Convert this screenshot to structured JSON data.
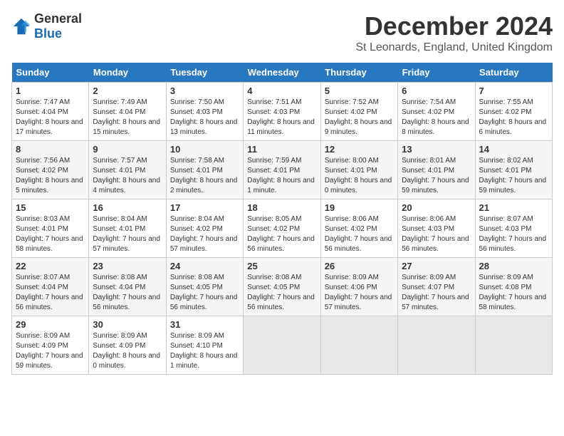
{
  "logo": {
    "general": "General",
    "blue": "Blue"
  },
  "title": "December 2024",
  "location": "St Leonards, England, United Kingdom",
  "days_of_week": [
    "Sunday",
    "Monday",
    "Tuesday",
    "Wednesday",
    "Thursday",
    "Friday",
    "Saturday"
  ],
  "weeks": [
    [
      {
        "day": "1",
        "sunrise": "Sunrise: 7:47 AM",
        "sunset": "Sunset: 4:04 PM",
        "daylight": "Daylight: 8 hours and 17 minutes."
      },
      {
        "day": "2",
        "sunrise": "Sunrise: 7:49 AM",
        "sunset": "Sunset: 4:04 PM",
        "daylight": "Daylight: 8 hours and 15 minutes."
      },
      {
        "day": "3",
        "sunrise": "Sunrise: 7:50 AM",
        "sunset": "Sunset: 4:03 PM",
        "daylight": "Daylight: 8 hours and 13 minutes."
      },
      {
        "day": "4",
        "sunrise": "Sunrise: 7:51 AM",
        "sunset": "Sunset: 4:03 PM",
        "daylight": "Daylight: 8 hours and 11 minutes."
      },
      {
        "day": "5",
        "sunrise": "Sunrise: 7:52 AM",
        "sunset": "Sunset: 4:02 PM",
        "daylight": "Daylight: 8 hours and 9 minutes."
      },
      {
        "day": "6",
        "sunrise": "Sunrise: 7:54 AM",
        "sunset": "Sunset: 4:02 PM",
        "daylight": "Daylight: 8 hours and 8 minutes."
      },
      {
        "day": "7",
        "sunrise": "Sunrise: 7:55 AM",
        "sunset": "Sunset: 4:02 PM",
        "daylight": "Daylight: 8 hours and 6 minutes."
      }
    ],
    [
      {
        "day": "8",
        "sunrise": "Sunrise: 7:56 AM",
        "sunset": "Sunset: 4:02 PM",
        "daylight": "Daylight: 8 hours and 5 minutes."
      },
      {
        "day": "9",
        "sunrise": "Sunrise: 7:57 AM",
        "sunset": "Sunset: 4:01 PM",
        "daylight": "Daylight: 8 hours and 4 minutes."
      },
      {
        "day": "10",
        "sunrise": "Sunrise: 7:58 AM",
        "sunset": "Sunset: 4:01 PM",
        "daylight": "Daylight: 8 hours and 2 minutes."
      },
      {
        "day": "11",
        "sunrise": "Sunrise: 7:59 AM",
        "sunset": "Sunset: 4:01 PM",
        "daylight": "Daylight: 8 hours and 1 minute."
      },
      {
        "day": "12",
        "sunrise": "Sunrise: 8:00 AM",
        "sunset": "Sunset: 4:01 PM",
        "daylight": "Daylight: 8 hours and 0 minutes."
      },
      {
        "day": "13",
        "sunrise": "Sunrise: 8:01 AM",
        "sunset": "Sunset: 4:01 PM",
        "daylight": "Daylight: 7 hours and 59 minutes."
      },
      {
        "day": "14",
        "sunrise": "Sunrise: 8:02 AM",
        "sunset": "Sunset: 4:01 PM",
        "daylight": "Daylight: 7 hours and 59 minutes."
      }
    ],
    [
      {
        "day": "15",
        "sunrise": "Sunrise: 8:03 AM",
        "sunset": "Sunset: 4:01 PM",
        "daylight": "Daylight: 7 hours and 58 minutes."
      },
      {
        "day": "16",
        "sunrise": "Sunrise: 8:04 AM",
        "sunset": "Sunset: 4:01 PM",
        "daylight": "Daylight: 7 hours and 57 minutes."
      },
      {
        "day": "17",
        "sunrise": "Sunrise: 8:04 AM",
        "sunset": "Sunset: 4:02 PM",
        "daylight": "Daylight: 7 hours and 57 minutes."
      },
      {
        "day": "18",
        "sunrise": "Sunrise: 8:05 AM",
        "sunset": "Sunset: 4:02 PM",
        "daylight": "Daylight: 7 hours and 56 minutes."
      },
      {
        "day": "19",
        "sunrise": "Sunrise: 8:06 AM",
        "sunset": "Sunset: 4:02 PM",
        "daylight": "Daylight: 7 hours and 56 minutes."
      },
      {
        "day": "20",
        "sunrise": "Sunrise: 8:06 AM",
        "sunset": "Sunset: 4:03 PM",
        "daylight": "Daylight: 7 hours and 56 minutes."
      },
      {
        "day": "21",
        "sunrise": "Sunrise: 8:07 AM",
        "sunset": "Sunset: 4:03 PM",
        "daylight": "Daylight: 7 hours and 56 minutes."
      }
    ],
    [
      {
        "day": "22",
        "sunrise": "Sunrise: 8:07 AM",
        "sunset": "Sunset: 4:04 PM",
        "daylight": "Daylight: 7 hours and 56 minutes."
      },
      {
        "day": "23",
        "sunrise": "Sunrise: 8:08 AM",
        "sunset": "Sunset: 4:04 PM",
        "daylight": "Daylight: 7 hours and 56 minutes."
      },
      {
        "day": "24",
        "sunrise": "Sunrise: 8:08 AM",
        "sunset": "Sunset: 4:05 PM",
        "daylight": "Daylight: 7 hours and 56 minutes."
      },
      {
        "day": "25",
        "sunrise": "Sunrise: 8:08 AM",
        "sunset": "Sunset: 4:05 PM",
        "daylight": "Daylight: 7 hours and 56 minutes."
      },
      {
        "day": "26",
        "sunrise": "Sunrise: 8:09 AM",
        "sunset": "Sunset: 4:06 PM",
        "daylight": "Daylight: 7 hours and 57 minutes."
      },
      {
        "day": "27",
        "sunrise": "Sunrise: 8:09 AM",
        "sunset": "Sunset: 4:07 PM",
        "daylight": "Daylight: 7 hours and 57 minutes."
      },
      {
        "day": "28",
        "sunrise": "Sunrise: 8:09 AM",
        "sunset": "Sunset: 4:08 PM",
        "daylight": "Daylight: 7 hours and 58 minutes."
      }
    ],
    [
      {
        "day": "29",
        "sunrise": "Sunrise: 8:09 AM",
        "sunset": "Sunset: 4:09 PM",
        "daylight": "Daylight: 7 hours and 59 minutes."
      },
      {
        "day": "30",
        "sunrise": "Sunrise: 8:09 AM",
        "sunset": "Sunset: 4:09 PM",
        "daylight": "Daylight: 8 hours and 0 minutes."
      },
      {
        "day": "31",
        "sunrise": "Sunrise: 8:09 AM",
        "sunset": "Sunset: 4:10 PM",
        "daylight": "Daylight: 8 hours and 1 minute."
      },
      null,
      null,
      null,
      null
    ]
  ]
}
